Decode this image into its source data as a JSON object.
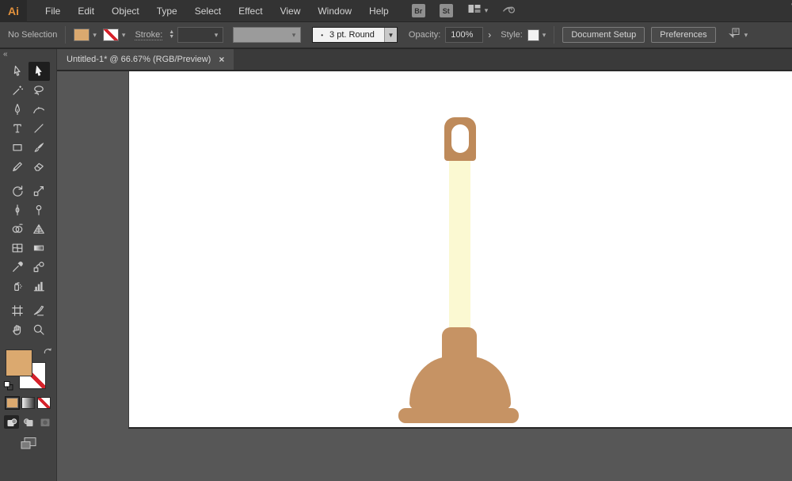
{
  "menubar": {
    "logo": "Ai",
    "items": [
      "File",
      "Edit",
      "Object",
      "Type",
      "Select",
      "Effect",
      "View",
      "Window",
      "Help"
    ],
    "bridge_button": "Br",
    "stock_button": "St",
    "partial_glyph": "\\"
  },
  "controlbar": {
    "selection_status": "No Selection",
    "fill_color": "#DBA96F",
    "stroke_label": "Stroke:",
    "brush_bullet": "•",
    "brush_definition": "3 pt. Round",
    "opacity_label": "Opacity:",
    "opacity_value": "100%",
    "opacity_more_glyph": "›",
    "style_label": "Style:",
    "document_setup_button": "Document Setup",
    "preferences_button": "Preferences"
  },
  "document_tab": {
    "title": "Untitled-1* @ 66.67% (RGB/Preview)",
    "close_glyph": "×"
  },
  "toolbar": {
    "collapse_glyph": "«",
    "groups": [
      [
        "selection",
        "direct-selection",
        "magic-wand",
        "lasso",
        "pen",
        "curvature",
        "type",
        "line-segment",
        "rectangle",
        "paintbrush",
        "shaper",
        "eraser"
      ],
      [
        "rotate",
        "scale",
        "width",
        "puppet-warp",
        "shape-builder",
        "perspective-grid",
        "mesh",
        "gradient",
        "eyedropper",
        "blend",
        "symbol-sprayer",
        "column-graph"
      ],
      [
        "artboard",
        "slice",
        "hand",
        "zoom"
      ]
    ],
    "active_tool": "direct-selection",
    "fill_color": "#DBA96F",
    "color_modes": [
      "color",
      "gradient",
      "none"
    ],
    "active_color_mode": "color",
    "drawing_modes": [
      "draw-normal",
      "draw-behind",
      "draw-inside"
    ],
    "active_drawing_mode": "draw-normal",
    "disabled_drawing_mode": "draw-inside"
  },
  "canvas": {
    "pasteboard_color": "#575757",
    "artboard_color": "#FFFFFF"
  },
  "artwork": {
    "subject": "plunger",
    "handle_grip_color": "#BE8A5A",
    "stick_color": "#FBF9D2",
    "cup_color": "#C69364"
  }
}
